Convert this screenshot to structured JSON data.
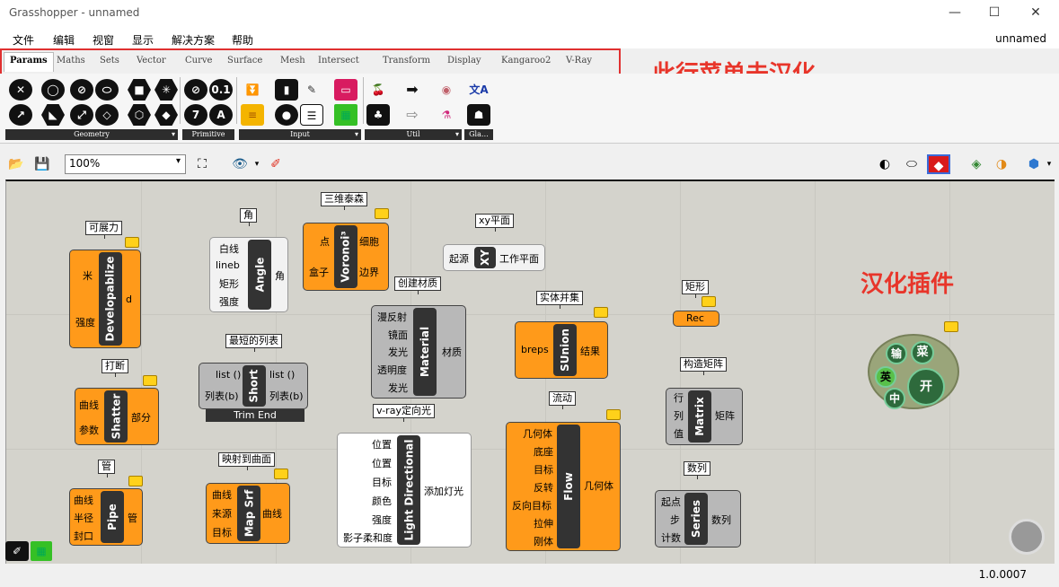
{
  "window": {
    "title": "Grasshopper - unnamed",
    "doc_name": "unnamed",
    "minimize": "—",
    "maximize": "☐",
    "close": "✕"
  },
  "menu": [
    "文件",
    "编辑",
    "视窗",
    "显示",
    "解决方案",
    "帮助"
  ],
  "tabs": [
    "Params",
    "Maths",
    "Sets",
    "Vector",
    "Curve",
    "Surface",
    "Mesh",
    "Intersect",
    "Transform",
    "Display",
    "Kangaroo2",
    "V-Ray"
  ],
  "annotations": {
    "menu_note": "此行菜单未汉化",
    "plugin_note": "汉化插件"
  },
  "ribbon_groups": [
    "Geometry",
    "Primitive",
    "Input",
    "Util",
    "Gla…"
  ],
  "toolbar2": {
    "zoom": "100%"
  },
  "components": {
    "developable": {
      "tag": "可展力",
      "name": "Developablize",
      "inputs": [
        "米",
        "强度"
      ],
      "outputs": [
        "d"
      ]
    },
    "shatter": {
      "tag": "打断",
      "name": "Shatter",
      "inputs": [
        "曲线",
        "参数"
      ],
      "outputs": [
        "部分"
      ]
    },
    "pipe": {
      "tag": "管",
      "name": "Pipe",
      "inputs": [
        "曲线",
        "半径",
        "封口"
      ],
      "outputs": [
        "管"
      ]
    },
    "angle": {
      "tag": "角",
      "name": "Angle",
      "inputs": [
        "白线",
        "lineb",
        "矩形",
        "强度"
      ],
      "outputs": [
        "角"
      ]
    },
    "short": {
      "tag": "最短的列表",
      "name": "Short",
      "inputs": [
        "list ()",
        "列表(b)"
      ],
      "outputs": [
        "list ()",
        "列表(b)"
      ],
      "caption": "Trim End"
    },
    "mapsrf": {
      "tag": "映射到曲面",
      "name": "Map Srf",
      "inputs": [
        "曲线",
        "来源",
        "目标"
      ],
      "outputs": [
        "曲线"
      ]
    },
    "voronoi": {
      "tag": "三维泰森",
      "name": "Voronoi³",
      "inputs": [
        "点",
        "盒子"
      ],
      "outputs": [
        "细胞",
        "边界"
      ]
    },
    "material": {
      "tag": "创建材质",
      "name": "Material",
      "inputs": [
        "漫反射",
        "镜面",
        "发光",
        "透明度",
        "发光"
      ],
      "outputs": [
        "材质"
      ]
    },
    "light": {
      "tag": "v-ray定向光",
      "name": "Light Directional",
      "inputs": [
        "位置",
        "位置",
        "目标",
        "颜色",
        "强度",
        "影子柔和度"
      ],
      "outputs": [
        "添加灯光"
      ]
    },
    "xy": {
      "tag": "xy平面",
      "name": "XY",
      "inputs": [
        "起源"
      ],
      "outputs": [
        "工作平面"
      ]
    },
    "sunion": {
      "tag": "实体并集",
      "name": "SUnion",
      "inputs": [
        "breps"
      ],
      "outputs": [
        "结果"
      ]
    },
    "flow": {
      "tag": "流动",
      "name": "Flow",
      "inputs": [
        "几何体",
        "底座",
        "目标",
        "反转",
        "反向目标",
        "拉伸",
        "刚体"
      ],
      "outputs": [
        "几何体"
      ]
    },
    "rec": {
      "tag": "矩形",
      "name": "Rec"
    },
    "matrix": {
      "tag": "构造矩阵",
      "name": "Matrix",
      "inputs": [
        "行",
        "列",
        "值"
      ],
      "outputs": [
        "矩阵"
      ]
    },
    "series": {
      "tag": "数列",
      "name": "Series",
      "inputs": [
        "起点",
        "步",
        "计数"
      ],
      "outputs": [
        "数列"
      ]
    }
  },
  "plugin": {
    "btn1": "输",
    "btn2": "菜",
    "btn3": "英",
    "btn4": "中",
    "btn5": "开"
  },
  "status": {
    "version": "1.0.0007"
  }
}
